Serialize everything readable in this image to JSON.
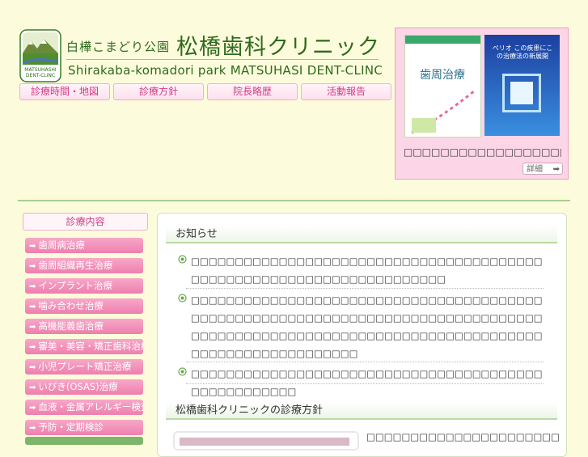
{
  "header": {
    "brand_jp_small": "白樺こまどり公園",
    "brand_jp_big": "松橋歯科クリニック",
    "brand_en": "Shirakaba-komadori park   MATSUHASI DENT-CLINC",
    "logo_label": "MATSUHASHI DENT-CLINC"
  },
  "nav": [
    {
      "label": "診療時間・地図"
    },
    {
      "label": "診療方針"
    },
    {
      "label": "院長略歴"
    },
    {
      "label": "活動報告"
    }
  ],
  "promo": {
    "text": "□□□□□□□□□□□□□□□□□□□□□□□",
    "detail_label": "詳細",
    "book1_title": "歯周治療",
    "book2_title": "ペリオ この疾患にこの治療法の新展開"
  },
  "sidebar": {
    "title": "診療内容",
    "items": [
      {
        "label": "歯周病治療"
      },
      {
        "label": "歯周組織再生治療"
      },
      {
        "label": "インプラント治療"
      },
      {
        "label": "噛み合わせ治療"
      },
      {
        "label": "高機能義歯治療"
      },
      {
        "label": "審美・美容・矯正歯科治療"
      },
      {
        "label": "小児プレート矯正治療"
      },
      {
        "label": "いびき(OSAS)治療"
      },
      {
        "label": "血液・金属アレルギー検査"
      },
      {
        "label": "予防・定期検診"
      }
    ]
  },
  "news": {
    "title": "お知らせ",
    "items": [
      {
        "text": "□□□□□□□□□□□□□□□□□□□□□□□□□□□□□□□□□□□□□□□□□□□□□□□□□□□□□□□□□□□□□□□□□□□□□"
      },
      {
        "text": "□□□□□□□□□□□□□□□□□□□□□□□□□□□□□□□□□□□□□□□□□□□□□□□□□□□□□□□□□□□□□□□□□□□□□□□□□□□□□□□□□□□□□□□□□□□□□□□□□□□□□□□□□□□□□□□□□□□□□□□□□□□□□□□□□□□□□□□□□□□"
      },
      {
        "text": "□□□□□□□□□□□□□□□□□□□□□□□□□□□□□□□□□□□□□□□□□□□□□□□□□□□□"
      }
    ]
  },
  "policy": {
    "title": "松橋歯科クリニックの診療方針",
    "text": "□□□□□□□□□□□□□□□□□□□□□□"
  },
  "colors": {
    "accent_pink": "#d23c84",
    "accent_green": "#2f6a1e",
    "background": "#fcfcdc"
  }
}
